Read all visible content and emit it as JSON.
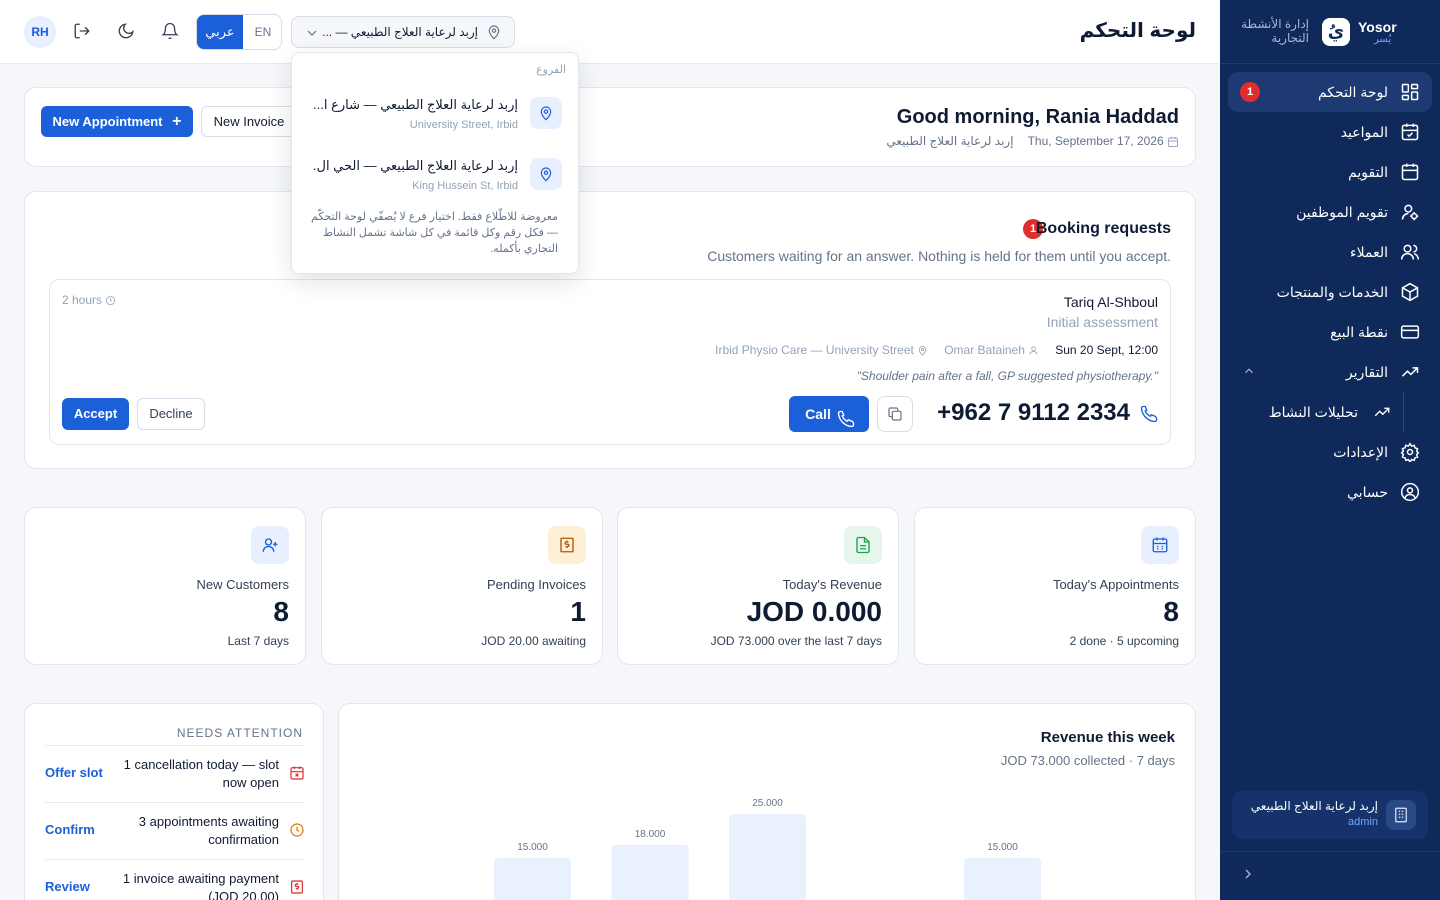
{
  "sidebar": {
    "brand_name": "Yosor",
    "brand_sub": "يُسر",
    "brand_logo": "يُ",
    "brand_tagline": "إدارة الأنشطة التجارية",
    "items": [
      {
        "label": "لوحة التحكم",
        "icon": "dashboard-icon",
        "badge": "1"
      },
      {
        "label": "المواعيد",
        "icon": "calendar-check-icon"
      },
      {
        "label": "التقويم",
        "icon": "calendar-icon"
      },
      {
        "label": "تقويم الموظفين",
        "icon": "staff-calendar-icon"
      },
      {
        "label": "العملاء",
        "icon": "users-icon"
      },
      {
        "label": "الخدمات والمنتجات",
        "icon": "box-icon"
      },
      {
        "label": "نقطة البيع",
        "icon": "credit-card-icon"
      },
      {
        "label": "التقارير",
        "icon": "trending-up-icon"
      },
      {
        "label": "تحليلات النشاط",
        "icon": "trending-up-icon"
      },
      {
        "label": "الإعدادات",
        "icon": "gear-icon"
      },
      {
        "label": "حسابي",
        "icon": "user-circle-icon"
      }
    ],
    "branch_name": "إربد لرعاية العلاج الطبيعي",
    "branch_role": "admin"
  },
  "topbar": {
    "title": "لوحة التحكم",
    "avatar": "RH",
    "lang_ar": "عربي",
    "lang_en": "EN",
    "branch_selected": "إربد لرعاية العلاج الطبيعي — ..."
  },
  "branch_dropdown": {
    "label": "الفروع",
    "items": [
      {
        "name": "إربد لرعاية العلاج الطبيعي — شارع ا...",
        "address": "University Street, Irbid"
      },
      {
        "name": "إربد لرعاية العلاج الطبيعي — الحي ال...",
        "address": "King Hussein St, Irbid"
      }
    ],
    "note": "معروضة للاطّلاع فقط. اختيار فرع لا يُصفّي لوحة التحكّم — فكل رقم وكل قائمة في كل شاشة تشمل النشاط التجاري بأكمله."
  },
  "greeting": {
    "title": "Good morning, Rania Haddad",
    "date": "Thu, September 17, 2026",
    "business": "إربد لرعاية العلاج الطبيعي",
    "new_appointment": "New Appointment",
    "new_invoice": "New Invoice"
  },
  "booking": {
    "title": "Booking requests",
    "badge": "1",
    "subtitle": "Customers waiting for an answer. Nothing is held for them until you accept.",
    "request": {
      "name": "Tariq Al-Shboul",
      "type": "Initial assessment",
      "datetime": "Sun 20 Sept, 12:00",
      "staff": "Omar Bataineh",
      "branch": "Irbid Physio Care — University Street",
      "note": "\"Shoulder pain after a fall, GP suggested physiotherapy.\"",
      "age": "2 hours",
      "phone": "+962 7 9112 2334",
      "call": "Call",
      "accept": "Accept",
      "decline": "Decline"
    }
  },
  "stats": [
    {
      "label": "Today's Appointments",
      "value": "8",
      "sub": "2 done · 5 upcoming",
      "icon": "calendar-icon",
      "color": "#1b5fd9",
      "bg": "#e8efff"
    },
    {
      "label": "Today's Revenue",
      "value": "JOD 0.000",
      "sub": "JOD 73.000 over the last 7 days",
      "icon": "document-icon",
      "color": "#16a34a",
      "bg": "#e6f6ec"
    },
    {
      "label": "Pending Invoices",
      "value": "1",
      "sub": "JOD 20.00 awaiting",
      "icon": "invoice-icon",
      "color": "#b45309",
      "bg": "#fdf0d5"
    },
    {
      "label": "New Customers",
      "value": "8",
      "sub": "Last 7 days",
      "icon": "user-plus-icon",
      "color": "#1b5fd9",
      "bg": "#e8efff"
    }
  ],
  "attention": {
    "title": "NEEDS ATTENTION",
    "items": [
      {
        "text": "1 cancellation today — slot now open",
        "action": "Offer slot",
        "icon": "calendar-x-icon",
        "color": "#e02d2d"
      },
      {
        "text": "3 appointments awaiting confirmation",
        "action": "Confirm",
        "icon": "clock-icon",
        "color": "#d97706"
      },
      {
        "text": "1 invoice awaiting payment (JOD 20.00)",
        "action": "Review",
        "icon": "invoice-icon",
        "color": "#e02d2d"
      }
    ]
  },
  "revenue": {
    "title": "Revenue this week",
    "subtitle": "JOD 73.000 collected · 7 days"
  },
  "chart_data": {
    "type": "bar",
    "values": [
      15.0,
      18.0,
      25.0,
      null,
      15.0
    ],
    "labels": [
      "15.000",
      "18.000",
      "25.000",
      "",
      "15.000"
    ],
    "ylim": [
      0,
      25
    ]
  }
}
